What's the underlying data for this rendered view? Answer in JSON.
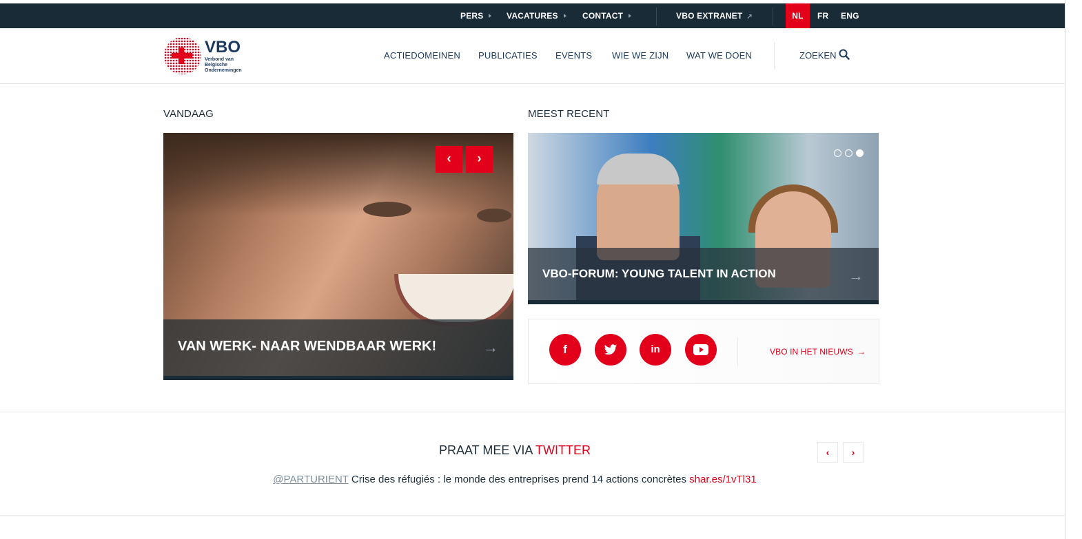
{
  "topbar": {
    "links": [
      {
        "label": "PERS"
      },
      {
        "label": "VACATURES"
      },
      {
        "label": "CONTACT"
      }
    ],
    "extranet": "VBO EXTRANET",
    "extranet_icon": "external-arrow-icon",
    "languages": [
      "NL",
      "FR",
      "ENG"
    ],
    "active_language": "NL"
  },
  "header": {
    "logo": {
      "title": "VBO",
      "subtitle": "Verbond van Belgische Ondernemingen"
    },
    "nav": [
      "ACTIEDOMEINEN",
      "PUBLICATIES",
      "EVENTS",
      "WIE WE ZIJN",
      "WAT WE DOEN"
    ],
    "search_label": "ZOEKEN",
    "search_icon": "search-icon"
  },
  "vandaag": {
    "title": "VANDAAG",
    "caption": "VAN WERK- NAAR WENDBAAR WERK!",
    "prev_icon": "‹",
    "next_icon": "›"
  },
  "meest_recent": {
    "title": "MEEST RECENT",
    "caption": "VBO-FORUM: YOUNG TALENT IN ACTION",
    "slide_count": 3,
    "active_slide": 3
  },
  "social": {
    "icons": [
      "facebook-icon",
      "twitter-icon",
      "linkedin-icon",
      "youtube-icon"
    ],
    "glyphs": [
      "f",
      "t",
      "in",
      "▶"
    ],
    "news_link": "VBO IN HET NIEUWS"
  },
  "twitter": {
    "title_prefix": "PRAAT MEE VIA",
    "title_accent": "TWITTER",
    "tweet_handle": "@PARTURIENT",
    "tweet_text": " Crise des réfugiés : le monde des entreprises prend 14 actions concrètes ",
    "tweet_url": "shar.es/1vTl31"
  },
  "colors": {
    "accent": "#e2001a",
    "topbar": "#1a2b38",
    "navy": "#1c3a5e"
  }
}
